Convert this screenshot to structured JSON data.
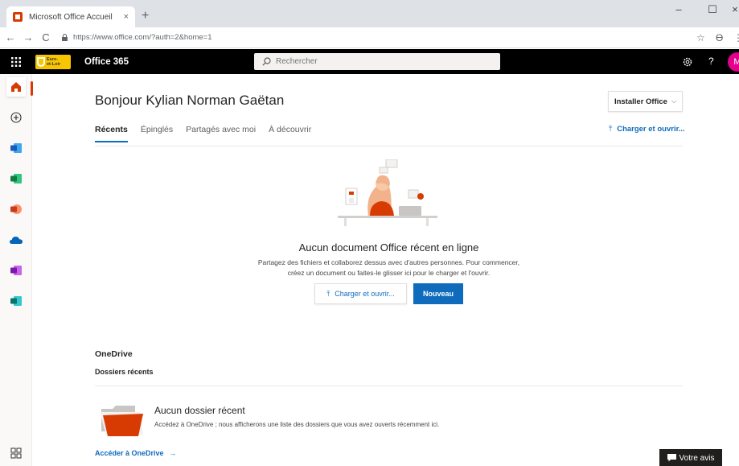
{
  "browser": {
    "tab_title": "Microsoft Office Accueil",
    "tab_close": "×",
    "new_tab": "+",
    "url": "https://www.office.com/?auth=2&home=1",
    "minimize": "–",
    "maximize": "☐",
    "close": "×",
    "back": "←",
    "forward": "→",
    "reload": "C",
    "bookmark": "☆",
    "profile": "Ɵ",
    "menu": "⋮"
  },
  "header": {
    "org_logo_line1": "Eure-",
    "org_logo_line2": "et-Loir",
    "app_name": "Office 365",
    "search_placeholder": "Rechercher",
    "help": "?",
    "avatar_initial": "M"
  },
  "main": {
    "greeting": "Bonjour Kylian Norman Gaëtan",
    "install_label": "Installer Office",
    "tabs": [
      {
        "label": "Récents"
      },
      {
        "label": "Épinglés"
      },
      {
        "label": "Partagés avec moi"
      },
      {
        "label": "À découvrir"
      }
    ],
    "upload_open": "Charger et ouvrir...",
    "empty_title": "Aucun document Office récent en ligne",
    "empty_desc_line1": "Partagez des fichiers et collaborez dessus avec d'autres personnes. Pour commencer,",
    "empty_desc_line2": "créez un document ou faites-le glisser ici pour le charger et l'ouvrir.",
    "btn_upload": "Charger et ouvrir...",
    "btn_new": "Nouveau"
  },
  "onedrive": {
    "title": "OneDrive",
    "subtitle": "Dossiers récents",
    "empty_title": "Aucun dossier récent",
    "empty_desc": "Accédez à OneDrive ; nous afficherons une liste des dossiers que vous avez ouverts récemment ici.",
    "link": "Accéder à OneDrive",
    "link_arrow": "→"
  },
  "feedback": {
    "label": "Votre avis"
  },
  "colors": {
    "accent": "#0f6cbd",
    "header_bg": "#000000",
    "brand_red": "#d83b01",
    "avatar": "#e3008c"
  }
}
